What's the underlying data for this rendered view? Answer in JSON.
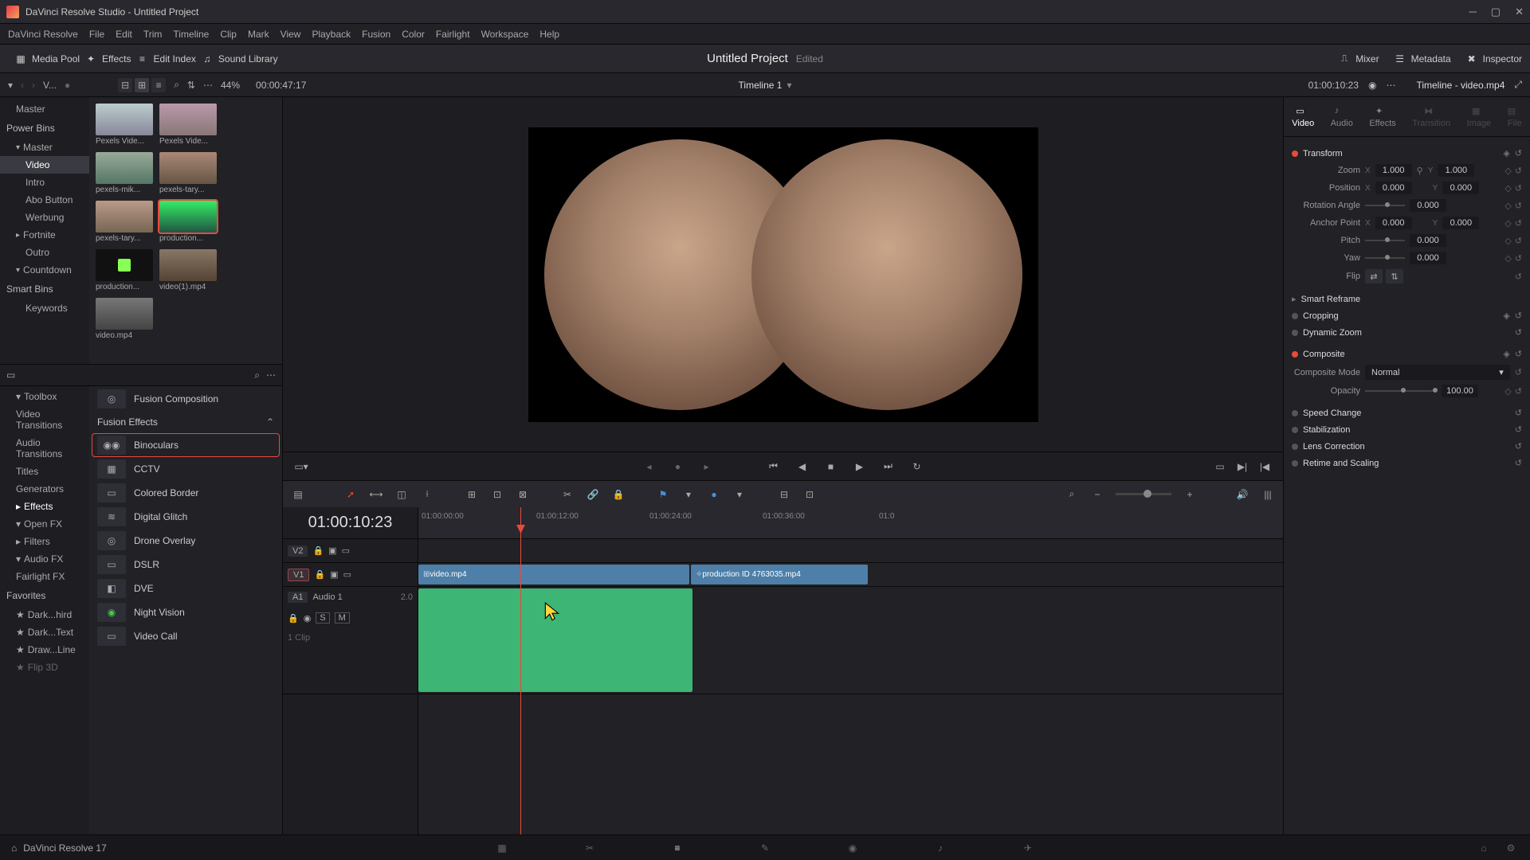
{
  "window": {
    "title": "DaVinci Resolve Studio - Untitled Project"
  },
  "menu": [
    "DaVinci Resolve",
    "File",
    "Edit",
    "Trim",
    "Timeline",
    "Clip",
    "Mark",
    "View",
    "Playback",
    "Fusion",
    "Color",
    "Fairlight",
    "Workspace",
    "Help"
  ],
  "top_toolbar": {
    "media_pool": "Media Pool",
    "effects": "Effects",
    "edit_index": "Edit Index",
    "sound_library": "Sound Library",
    "mixer": "Mixer",
    "metadata": "Metadata",
    "inspector": "Inspector"
  },
  "project": {
    "name": "Untitled Project",
    "status": "Edited"
  },
  "secondbar": {
    "dropdown": "V...",
    "zoom": "44%",
    "timecode": "00:00:47:17",
    "timeline_name": "Timeline 1",
    "right_timecode": "01:00:10:23",
    "inspector_header": "Timeline - video.mp4"
  },
  "bins": {
    "master": "Master",
    "power_bins": "Power Bins",
    "items": [
      "Master",
      "Video",
      "Intro",
      "Abo Button",
      "Werbung",
      "Fortnite",
      "Outro",
      "Countdown"
    ],
    "smart_bins": "Smart Bins",
    "keywords": "Keywords"
  },
  "thumbs": [
    {
      "label": "Pexels Vide..."
    },
    {
      "label": "Pexels Vide..."
    },
    {
      "label": "pexels-mik..."
    },
    {
      "label": "pexels-tary..."
    },
    {
      "label": "pexels-tary..."
    },
    {
      "label": "production...",
      "selected": true
    },
    {
      "label": "production..."
    },
    {
      "label": "video(1).mp4"
    },
    {
      "label": "video.mp4"
    }
  ],
  "fx_tree": {
    "toolbox": "Toolbox",
    "items": [
      "Video Transitions",
      "Audio Transitions",
      "Titles",
      "Generators",
      "Effects"
    ],
    "openfx": "Open FX",
    "filters": "Filters",
    "audiofx": "Audio FX",
    "fairlight": "Fairlight FX",
    "favorites": "Favorites",
    "fav_items": [
      "Dark...hird",
      "Dark...Text",
      "Draw...Line",
      "Flip 3D"
    ]
  },
  "fx_panel": {
    "fusion_comp": "Fusion Composition",
    "header": "Fusion Effects",
    "items": [
      "Binoculars",
      "CCTV",
      "Colored Border",
      "Digital Glitch",
      "Drone Overlay",
      "DSLR",
      "DVE",
      "Night Vision",
      "Video Call"
    ]
  },
  "timeline": {
    "big_tc": "01:00:10:23",
    "ruler_ticks": [
      "01:00:00:00",
      "01:00:12:00",
      "01:00:24:00",
      "01:00:36:00",
      "01:0"
    ],
    "v2": "V2",
    "v1": "V1",
    "a1": "A1",
    "audio_label": "Audio 1",
    "a1_ch": "2.0",
    "clip1": "video.mp4",
    "clip2": "production ID 4763035.mp4",
    "clip_count": "1 Clip"
  },
  "inspector": {
    "tabs": [
      "Video",
      "Audio",
      "Effects",
      "Transition",
      "Image",
      "File"
    ],
    "transform": "Transform",
    "zoom_l": "Zoom",
    "zoom_x": "1.000",
    "zoom_y": "1.000",
    "pos_l": "Position",
    "pos_x": "0.000",
    "pos_y": "0.000",
    "rot_l": "Rotation Angle",
    "rot_v": "0.000",
    "anchor_l": "Anchor Point",
    "anchor_x": "0.000",
    "anchor_y": "0.000",
    "pitch_l": "Pitch",
    "pitch_v": "0.000",
    "yaw_l": "Yaw",
    "yaw_v": "0.000",
    "flip_l": "Flip",
    "smart_reframe": "Smart Reframe",
    "cropping": "Cropping",
    "dynamic_zoom": "Dynamic Zoom",
    "composite": "Composite",
    "comp_mode_l": "Composite Mode",
    "comp_mode_v": "Normal",
    "opacity_l": "Opacity",
    "opacity_v": "100.00",
    "speed": "Speed Change",
    "stabilization": "Stabilization",
    "lens": "Lens Correction",
    "retime": "Retime and Scaling"
  },
  "footer": {
    "version": "DaVinci Resolve 17"
  }
}
